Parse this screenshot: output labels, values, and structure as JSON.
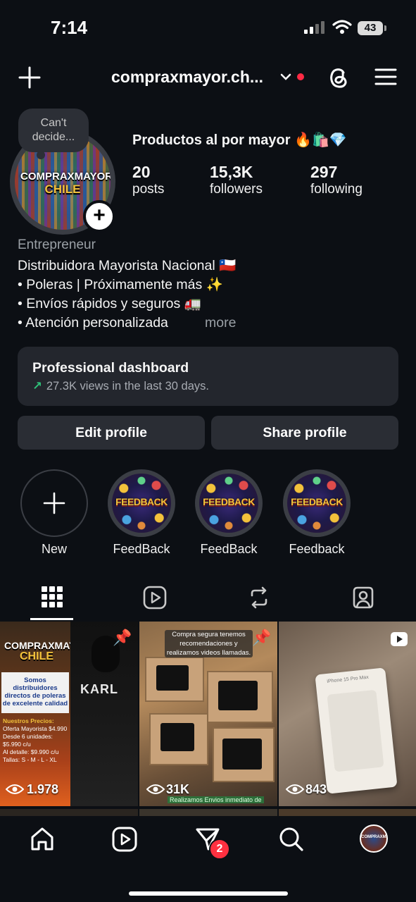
{
  "status_bar": {
    "time": "7:14",
    "battery": "43"
  },
  "header": {
    "username": "compraxmayor.ch..."
  },
  "profile": {
    "note": "Can't decide...",
    "avatar_text_line1": "COMPRAXMAYOR",
    "avatar_text_line2": "CHILE",
    "name": "Productos al por mayor 🔥🛍️💎",
    "stats": [
      {
        "value": "20",
        "label": "posts"
      },
      {
        "value": "15,3K",
        "label": "followers"
      },
      {
        "value": "297",
        "label": "following"
      }
    ],
    "category": "Entrepreneur",
    "bio": [
      "Distribuidora Mayorista Nacional 🇨🇱",
      "• Poleras | Próximamente más ✨",
      "• Envíos rápidos y seguros 🚛",
      "• Atención personalizada"
    ],
    "more": "more"
  },
  "dashboard": {
    "title": "Professional dashboard",
    "subtitle": "27.3K views in the last 30 days."
  },
  "buttons": {
    "edit": "Edit profile",
    "share": "Share profile"
  },
  "highlights": [
    {
      "label": "New"
    },
    {
      "label": "FeedBack",
      "cover_text": "FEEDBACK"
    },
    {
      "label": "FeedBack",
      "cover_text": "FEEDBACK"
    },
    {
      "label": "Feedback",
      "cover_text": "FEEDBACK"
    }
  ],
  "posts": [
    {
      "views": "1.978",
      "pinned": true,
      "logo_line1": "COMPRAXMAYOR",
      "logo_line2": "CHILE",
      "card_text": "Somos distribuidores directos de poleras de excelente calidad",
      "list": [
        "Nuestros Precios:",
        "Oferta Mayorista $4.990",
        "Desde 6 unidades: $5.990 c/u",
        "Al detalle: $9.990 c/u",
        "Tallas: S - M - L - XL"
      ],
      "shirt_text": "KARL"
    },
    {
      "views": "31K",
      "pinned": true,
      "caption": "Compra segura tenemos recomendaciones y realizamos videos llamadas.",
      "footer": "Realizamos Envios inmediato de"
    },
    {
      "views": "843",
      "reel": true,
      "box_text": "iPhone 15 Pro Max"
    }
  ],
  "nav": {
    "messages_badge": "2"
  }
}
